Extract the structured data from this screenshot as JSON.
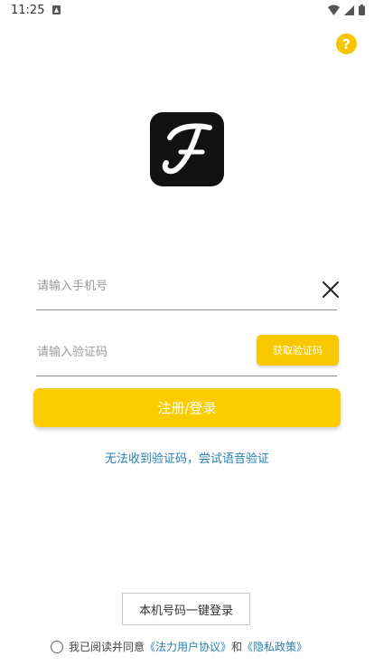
{
  "status_bar": {
    "time": "11:25"
  },
  "colors": {
    "accent": "#fbcc00",
    "link": "#2a7fb3"
  },
  "help": {
    "label": "?"
  },
  "login": {
    "phone_placeholder": "请输入手机号",
    "code_placeholder": "请输入验证码",
    "get_code_label": "获取验证码",
    "submit_label": "注册/登录",
    "voice_link": "无法收到验证码，尝试语音验证",
    "one_click_label": "本机号码一键登录"
  },
  "agreement": {
    "prefix": "我已阅读并同意",
    "user_agreement": "《法力用户协议》",
    "and": "和",
    "privacy_policy": "《隐私政策》"
  }
}
